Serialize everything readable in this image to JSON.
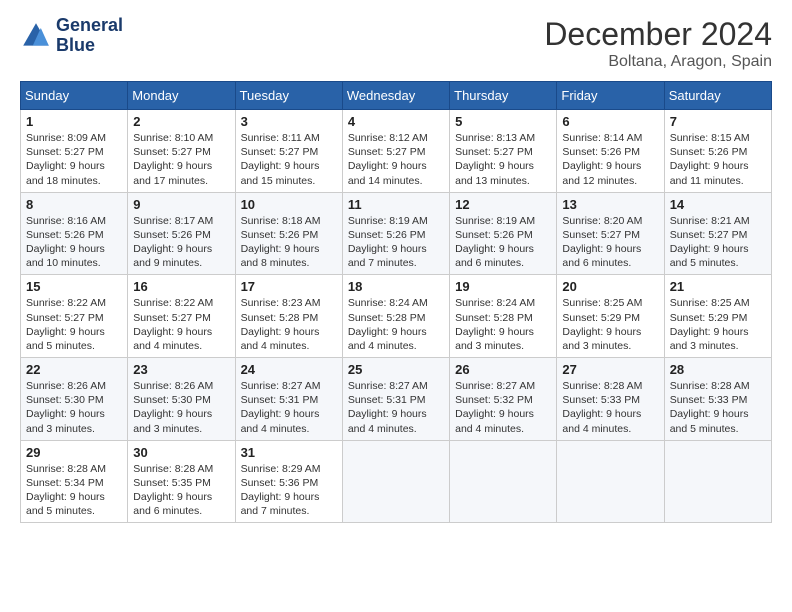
{
  "header": {
    "logo_line1": "General",
    "logo_line2": "Blue",
    "title": "December 2024",
    "subtitle": "Boltana, Aragon, Spain"
  },
  "calendar": {
    "days_of_week": [
      "Sunday",
      "Monday",
      "Tuesday",
      "Wednesday",
      "Thursday",
      "Friday",
      "Saturday"
    ],
    "weeks": [
      [
        {
          "day": "",
          "info": ""
        },
        {
          "day": "2",
          "info": "Sunrise: 8:10 AM\nSunset: 5:27 PM\nDaylight: 9 hours\nand 17 minutes."
        },
        {
          "day": "3",
          "info": "Sunrise: 8:11 AM\nSunset: 5:27 PM\nDaylight: 9 hours\nand 15 minutes."
        },
        {
          "day": "4",
          "info": "Sunrise: 8:12 AM\nSunset: 5:27 PM\nDaylight: 9 hours\nand 14 minutes."
        },
        {
          "day": "5",
          "info": "Sunrise: 8:13 AM\nSunset: 5:27 PM\nDaylight: 9 hours\nand 13 minutes."
        },
        {
          "day": "6",
          "info": "Sunrise: 8:14 AM\nSunset: 5:26 PM\nDaylight: 9 hours\nand 12 minutes."
        },
        {
          "day": "7",
          "info": "Sunrise: 8:15 AM\nSunset: 5:26 PM\nDaylight: 9 hours\nand 11 minutes."
        }
      ],
      [
        {
          "day": "1",
          "info": "Sunrise: 8:09 AM\nSunset: 5:27 PM\nDaylight: 9 hours\nand 18 minutes."
        },
        {
          "day": "",
          "info": ""
        },
        {
          "day": "",
          "info": ""
        },
        {
          "day": "",
          "info": ""
        },
        {
          "day": "",
          "info": ""
        },
        {
          "day": "",
          "info": ""
        },
        {
          "day": "",
          "info": ""
        }
      ],
      [
        {
          "day": "8",
          "info": "Sunrise: 8:16 AM\nSunset: 5:26 PM\nDaylight: 9 hours\nand 10 minutes."
        },
        {
          "day": "9",
          "info": "Sunrise: 8:17 AM\nSunset: 5:26 PM\nDaylight: 9 hours\nand 9 minutes."
        },
        {
          "day": "10",
          "info": "Sunrise: 8:18 AM\nSunset: 5:26 PM\nDaylight: 9 hours\nand 8 minutes."
        },
        {
          "day": "11",
          "info": "Sunrise: 8:19 AM\nSunset: 5:26 PM\nDaylight: 9 hours\nand 7 minutes."
        },
        {
          "day": "12",
          "info": "Sunrise: 8:19 AM\nSunset: 5:26 PM\nDaylight: 9 hours\nand 6 minutes."
        },
        {
          "day": "13",
          "info": "Sunrise: 8:20 AM\nSunset: 5:27 PM\nDaylight: 9 hours\nand 6 minutes."
        },
        {
          "day": "14",
          "info": "Sunrise: 8:21 AM\nSunset: 5:27 PM\nDaylight: 9 hours\nand 5 minutes."
        }
      ],
      [
        {
          "day": "15",
          "info": "Sunrise: 8:22 AM\nSunset: 5:27 PM\nDaylight: 9 hours\nand 5 minutes."
        },
        {
          "day": "16",
          "info": "Sunrise: 8:22 AM\nSunset: 5:27 PM\nDaylight: 9 hours\nand 4 minutes."
        },
        {
          "day": "17",
          "info": "Sunrise: 8:23 AM\nSunset: 5:28 PM\nDaylight: 9 hours\nand 4 minutes."
        },
        {
          "day": "18",
          "info": "Sunrise: 8:24 AM\nSunset: 5:28 PM\nDaylight: 9 hours\nand 4 minutes."
        },
        {
          "day": "19",
          "info": "Sunrise: 8:24 AM\nSunset: 5:28 PM\nDaylight: 9 hours\nand 3 minutes."
        },
        {
          "day": "20",
          "info": "Sunrise: 8:25 AM\nSunset: 5:29 PM\nDaylight: 9 hours\nand 3 minutes."
        },
        {
          "day": "21",
          "info": "Sunrise: 8:25 AM\nSunset: 5:29 PM\nDaylight: 9 hours\nand 3 minutes."
        }
      ],
      [
        {
          "day": "22",
          "info": "Sunrise: 8:26 AM\nSunset: 5:30 PM\nDaylight: 9 hours\nand 3 minutes."
        },
        {
          "day": "23",
          "info": "Sunrise: 8:26 AM\nSunset: 5:30 PM\nDaylight: 9 hours\nand 3 minutes."
        },
        {
          "day": "24",
          "info": "Sunrise: 8:27 AM\nSunset: 5:31 PM\nDaylight: 9 hours\nand 4 minutes."
        },
        {
          "day": "25",
          "info": "Sunrise: 8:27 AM\nSunset: 5:31 PM\nDaylight: 9 hours\nand 4 minutes."
        },
        {
          "day": "26",
          "info": "Sunrise: 8:27 AM\nSunset: 5:32 PM\nDaylight: 9 hours\nand 4 minutes."
        },
        {
          "day": "27",
          "info": "Sunrise: 8:28 AM\nSunset: 5:33 PM\nDaylight: 9 hours\nand 4 minutes."
        },
        {
          "day": "28",
          "info": "Sunrise: 8:28 AM\nSunset: 5:33 PM\nDaylight: 9 hours\nand 5 minutes."
        }
      ],
      [
        {
          "day": "29",
          "info": "Sunrise: 8:28 AM\nSunset: 5:34 PM\nDaylight: 9 hours\nand 5 minutes."
        },
        {
          "day": "30",
          "info": "Sunrise: 8:28 AM\nSunset: 5:35 PM\nDaylight: 9 hours\nand 6 minutes."
        },
        {
          "day": "31",
          "info": "Sunrise: 8:29 AM\nSunset: 5:36 PM\nDaylight: 9 hours\nand 7 minutes."
        },
        {
          "day": "",
          "info": ""
        },
        {
          "day": "",
          "info": ""
        },
        {
          "day": "",
          "info": ""
        },
        {
          "day": "",
          "info": ""
        }
      ]
    ]
  }
}
